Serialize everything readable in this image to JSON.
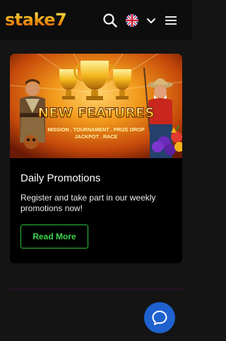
{
  "header": {
    "logo_text": "stake7",
    "icons": [
      "search-icon",
      "uk-flag-icon",
      "chevron-down-icon",
      "hamburger-menu-icon"
    ]
  },
  "promo_card": {
    "banner": {
      "headline": "NEW FEATURES",
      "line1": "MISSION . TOURNAMENT . PRIZE DROP",
      "line2": "JACKPOT . RACE"
    },
    "title": "Daily Promotions",
    "description": "Register and take part in our weekly promotions now!",
    "button_label": "Read More"
  },
  "chat_widget": {
    "icon": "chat-bubble-icon"
  },
  "colors": {
    "background": "#141414",
    "header": "#0d0d0d",
    "card": "#000000",
    "accent_green": "#2ec13a",
    "chat_blue": "#1f62cf"
  }
}
